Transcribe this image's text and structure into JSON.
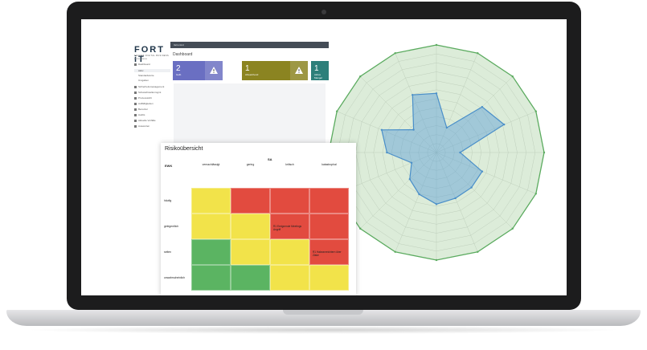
{
  "app": {
    "logo": "FORT iT",
    "logo_tagline": "SECURE DIGITAL BUSINESS",
    "logo_sub": "IT-Compliance",
    "topbar_title": "ItsControl",
    "page_title": "Dashboard",
    "nav": [
      {
        "label": "Dashboard",
        "sub": false
      },
      {
        "label": "Aktiv",
        "sub": true,
        "active": true
      },
      {
        "label": "Standardwerte",
        "sub": true
      },
      {
        "label": "Umgaben",
        "sub": true
      },
      {
        "label": "Sicherheitsmanagement",
        "sub": false
      },
      {
        "label": "Schwachstellenmgmt",
        "sub": false
      },
      {
        "label": "Prozesssicht",
        "sub": false
      },
      {
        "label": "Auffälligkeiten",
        "sub": false
      },
      {
        "label": "Benutzer",
        "sub": false
      },
      {
        "label": "Audits",
        "sub": false
      },
      {
        "label": "Aktuelle Vorfälle",
        "sub": false
      },
      {
        "label": "Auswerten",
        "sub": false
      }
    ],
    "cards": [
      {
        "value": "2",
        "label": "Gelb",
        "color": "#6a6fc2"
      },
      {
        "value": "1",
        "label": "Abweichend",
        "color": "#8b8421"
      },
      {
        "value": "1",
        "label": "Aktive Mangel",
        "color": "#2d7f7a"
      }
    ]
  },
  "risk_matrix": {
    "title": "Risikoübersicht",
    "x_axis_label": "SA",
    "y_axis_label": "EWK",
    "columns": [
      "vernachlässigt",
      "gering",
      "kritisch",
      "katastrophal"
    ],
    "rows": [
      {
        "label": "häufig",
        "cells": [
          {
            "color": "yellow",
            "text": ""
          },
          {
            "color": "red",
            "text": ""
          },
          {
            "color": "red",
            "text": ""
          },
          {
            "color": "red",
            "text": ""
          }
        ]
      },
      {
        "label": "gelegentlich",
        "cells": [
          {
            "color": "yellow",
            "text": ""
          },
          {
            "color": "yellow",
            "text": ""
          },
          {
            "color": "red",
            "text": "R1 Ereignende Meetings\nAngriff"
          },
          {
            "color": "red",
            "text": ""
          }
        ]
      },
      {
        "label": "selten",
        "cells": [
          {
            "color": "green",
            "text": ""
          },
          {
            "color": "yellow",
            "text": ""
          },
          {
            "color": "yellow",
            "text": ""
          },
          {
            "color": "red",
            "text": "R1 Hakeanreichtern über\nZlake"
          }
        ]
      },
      {
        "label": "unwahrscheinlich",
        "cells": [
          {
            "color": "green",
            "text": ""
          },
          {
            "color": "green",
            "text": ""
          },
          {
            "color": "yellow",
            "text": ""
          },
          {
            "color": "yellow",
            "text": ""
          }
        ]
      }
    ]
  },
  "radar": {
    "outer_color": "#5bab5f",
    "inner_color": "#4a8fc9",
    "axes_count": 16,
    "rings": 12,
    "values": [
      0.55,
      0.25,
      0.6,
      0.68,
      0.22,
      0.46,
      0.46,
      0.46,
      0.48,
      0.42,
      0.35,
      0.25,
      0.46,
      0.55,
      0.3,
      0.58
    ]
  }
}
